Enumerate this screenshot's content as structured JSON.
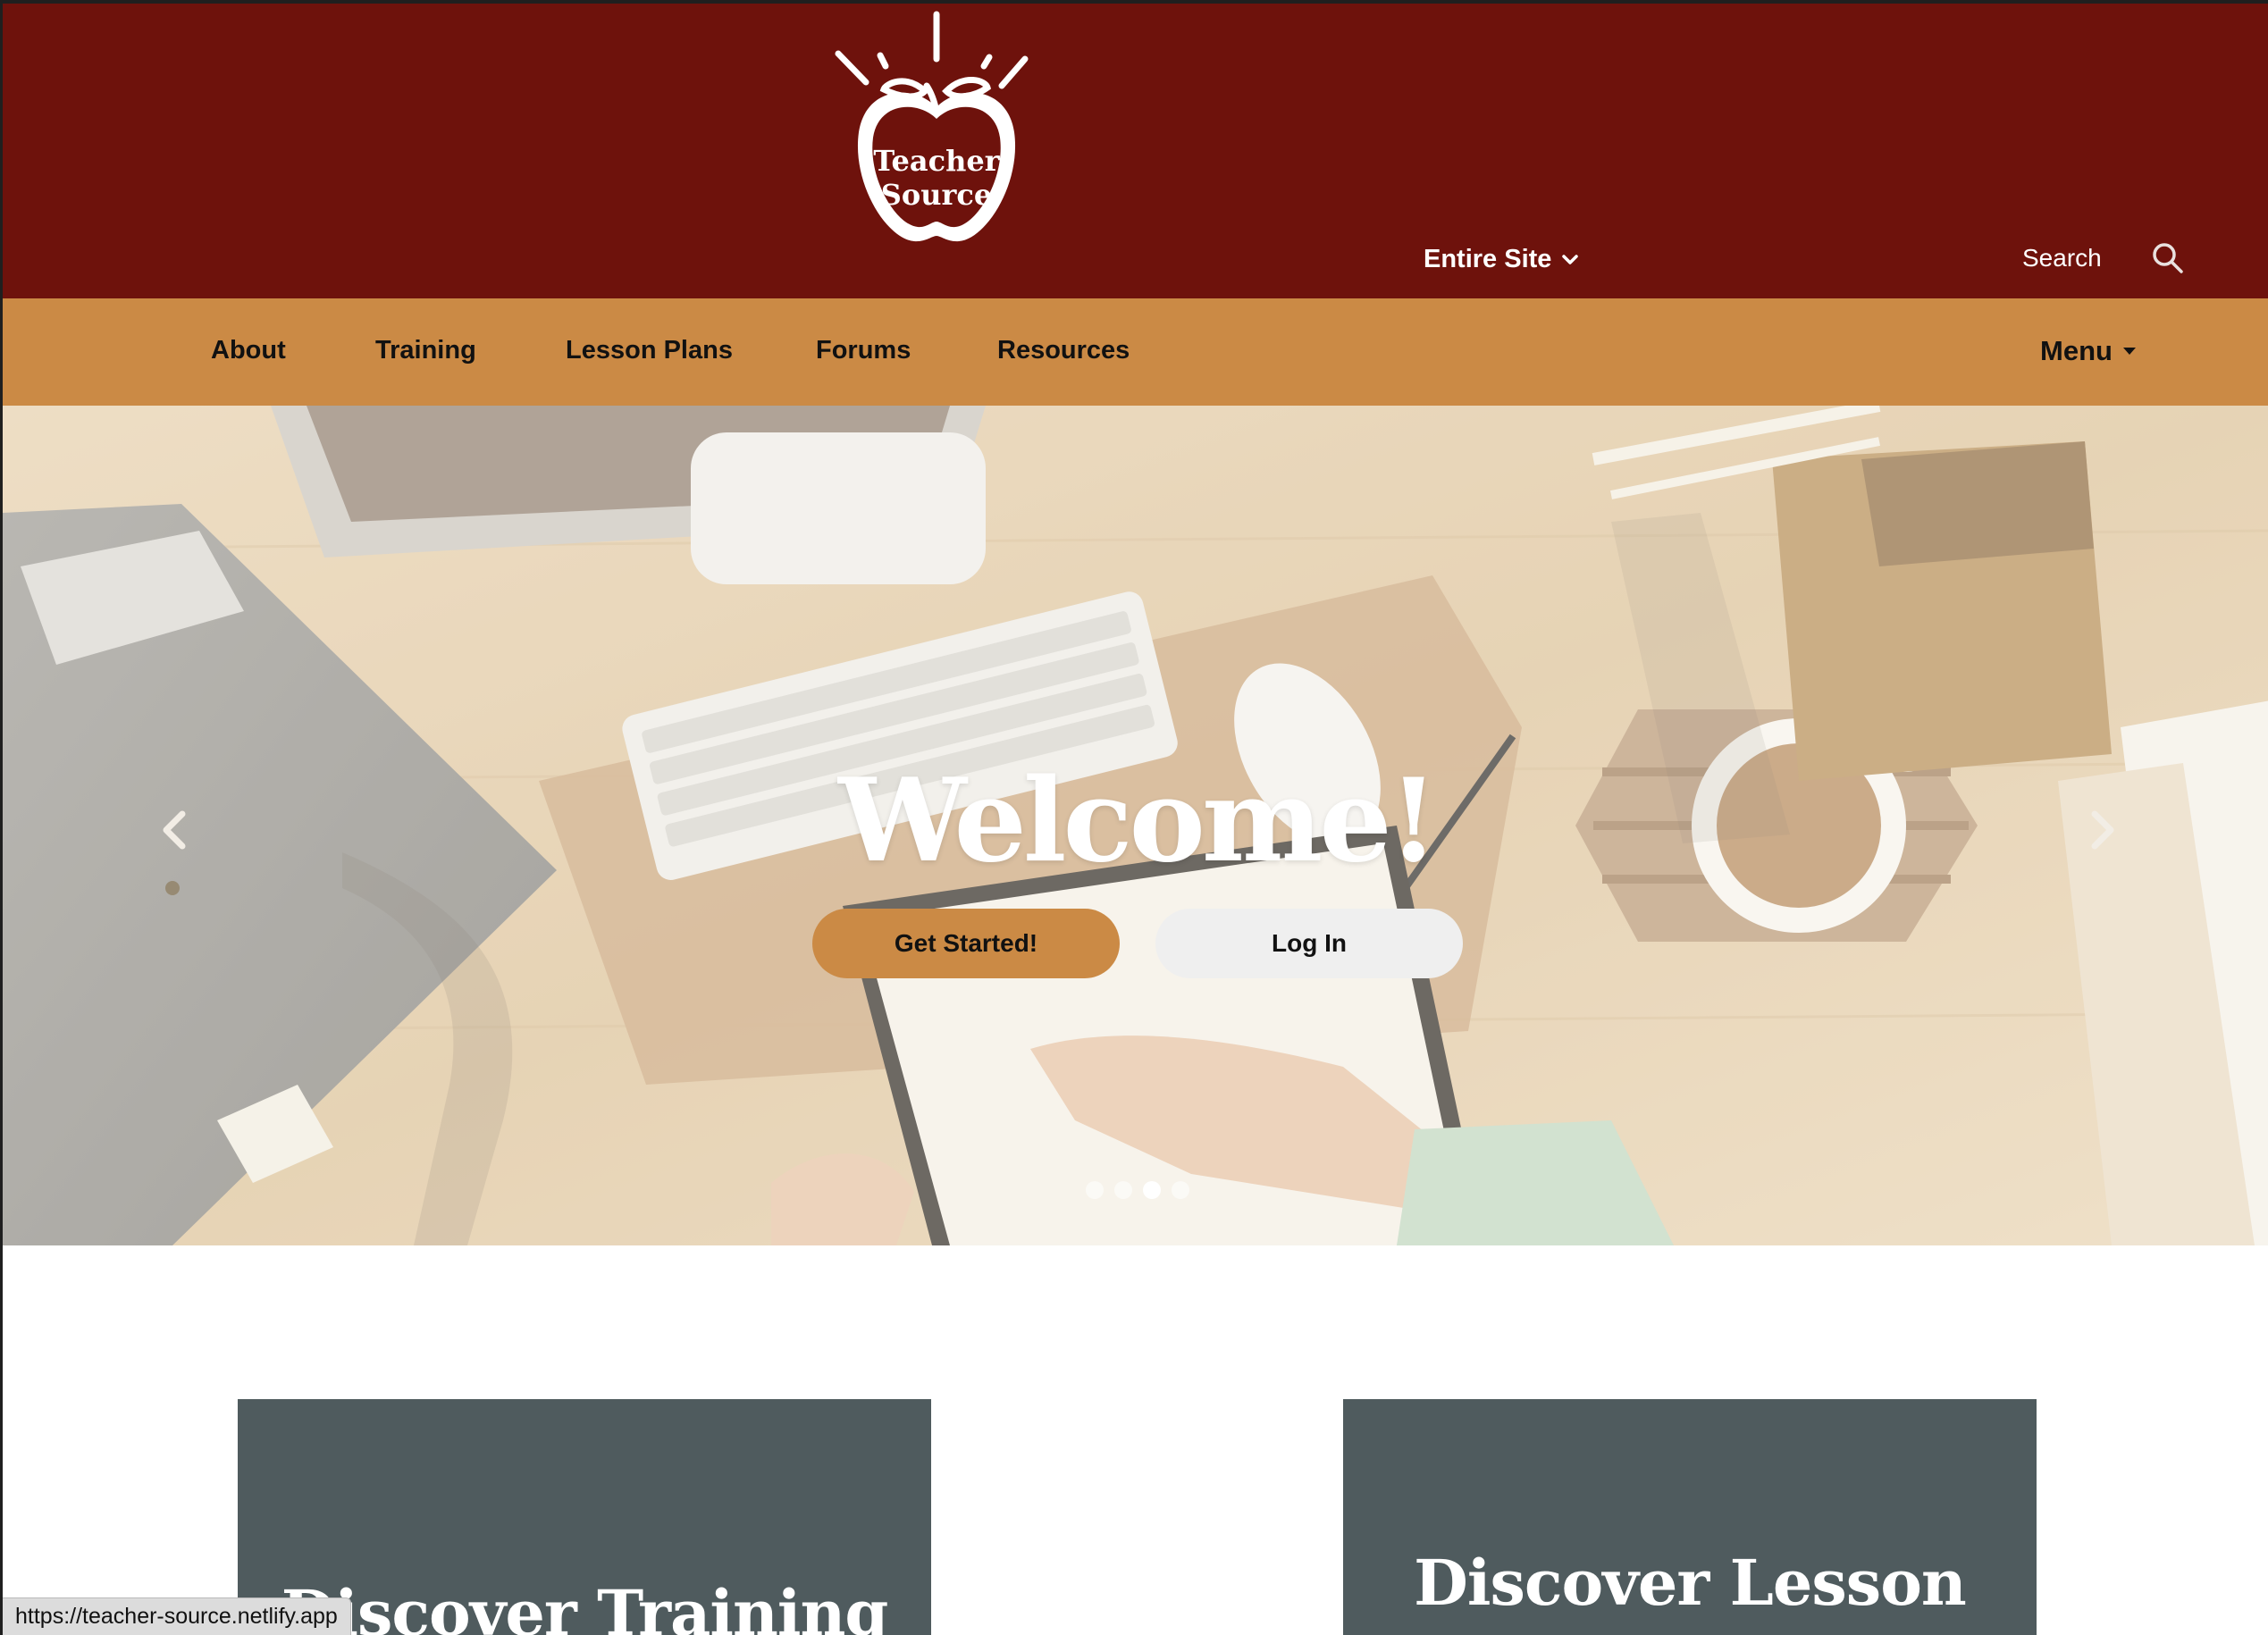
{
  "header": {
    "logo_text_line1": "Teacher",
    "logo_text_line2": "Source",
    "scope_label": "Entire Site",
    "search_placeholder": "Search"
  },
  "nav": {
    "items": [
      {
        "label": "About"
      },
      {
        "label": "Training"
      },
      {
        "label": "Lesson Plans"
      },
      {
        "label": "Forums"
      },
      {
        "label": "Resources"
      }
    ],
    "menu_label": "Menu"
  },
  "hero": {
    "title": "Welcome!",
    "primary_button": "Get Started!",
    "secondary_button": "Log In",
    "slides_total": 4,
    "active_slide": 3
  },
  "cards": [
    {
      "title": "Discover Training"
    },
    {
      "title": "Discover Lesson"
    }
  ],
  "status_bar": {
    "url": "https://teacher-source.netlify.app"
  },
  "colors": {
    "header_bg": "#6e120c",
    "nav_bg": "#cb8a45",
    "primary_button": "#cb8a45",
    "secondary_button": "#efefef",
    "card_bg": "#4f5b5e"
  }
}
